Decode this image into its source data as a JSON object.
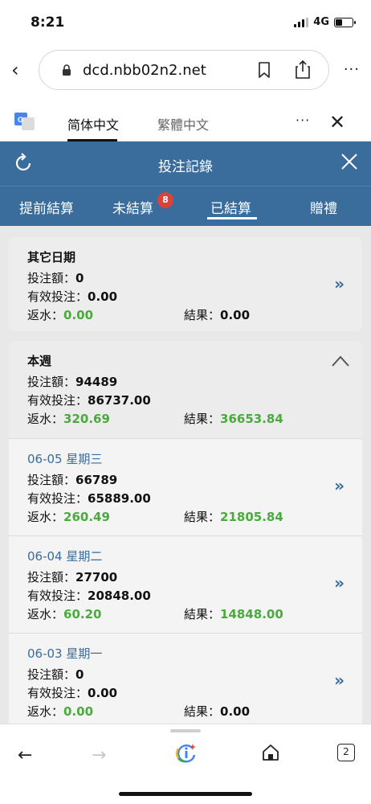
{
  "status_bar": {
    "time": "8:21",
    "network": "4G"
  },
  "browser": {
    "url": "dcd.nbb02n2.net",
    "tab_count": "2"
  },
  "translate_bar": {
    "lang_active": "简体中文",
    "lang_inactive": "繁體中文"
  },
  "header": {
    "title": "投注記錄"
  },
  "tabs": [
    {
      "label": "提前結算"
    },
    {
      "label": "未結算",
      "badge": "8"
    },
    {
      "label": "已結算"
    },
    {
      "label": "贈禮"
    }
  ],
  "labels": {
    "bet_amount": "投注額：",
    "valid_bet": "有效投注：",
    "rebate": "返水：",
    "result": "結果："
  },
  "other_dates": {
    "title": "其它日期",
    "bet_amount": "0",
    "valid_bet": "0.00",
    "rebate": "0.00",
    "result": "0.00"
  },
  "this_week": {
    "title": "本週",
    "bet_amount": "94489",
    "valid_bet": "86737.00",
    "rebate": "320.69",
    "result": "36653.84"
  },
  "days": [
    {
      "title": "06-05 星期三",
      "bet_amount": "66789",
      "valid_bet": "65889.00",
      "rebate": "260.49",
      "result": "21805.84"
    },
    {
      "title": "06-04 星期二",
      "bet_amount": "27700",
      "valid_bet": "20848.00",
      "rebate": "60.20",
      "result": "14848.00"
    },
    {
      "title": "06-03 星期一",
      "bet_amount": "0",
      "valid_bet": "0.00",
      "rebate": "0.00",
      "result": "0.00"
    }
  ],
  "colors": {
    "header_bg": "#3a6c9c",
    "green_value": "#4aaa3e",
    "badge": "#d8433a"
  }
}
